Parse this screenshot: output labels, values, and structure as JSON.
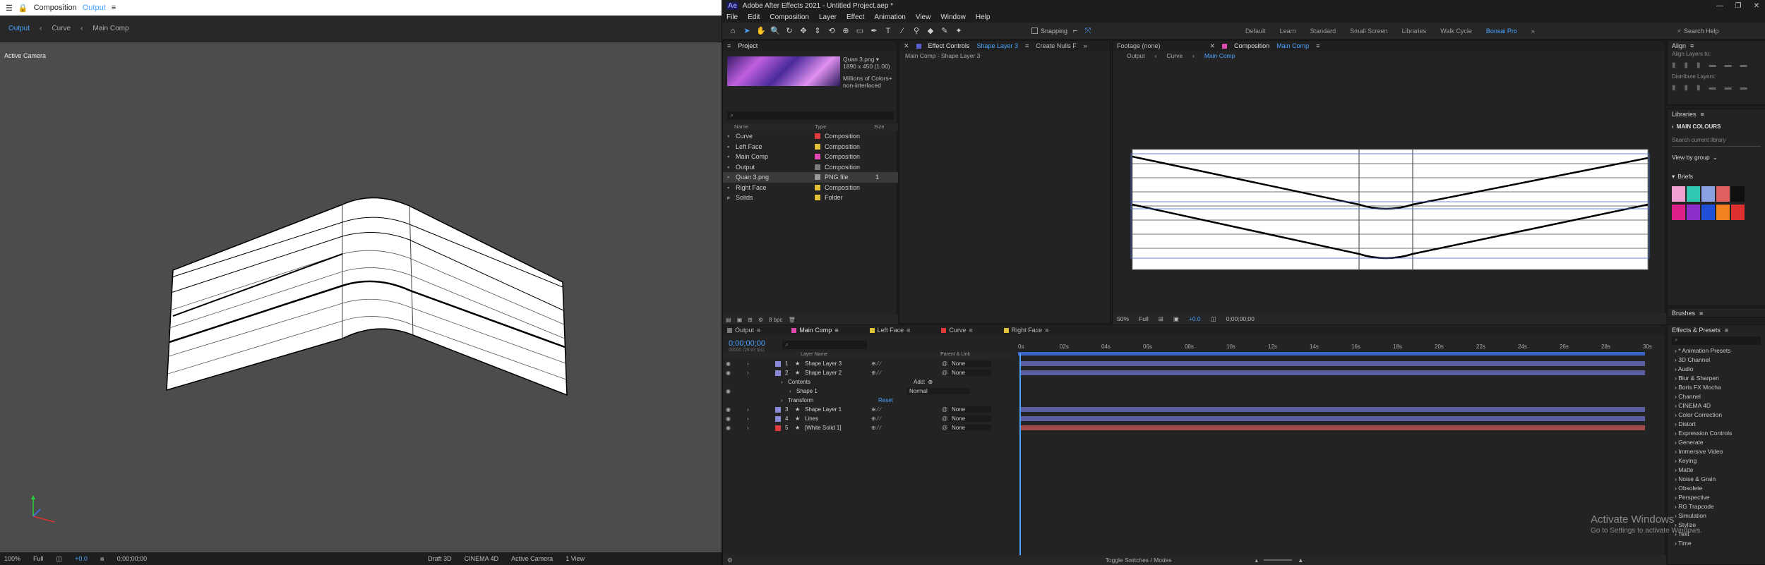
{
  "left_window": {
    "title": "Composition",
    "title_comp": "Output",
    "tabs": [
      "Output",
      "Curve",
      "Main Comp"
    ],
    "viewer_label": "Active Camera",
    "footer": [
      "100%",
      "Full",
      "+0.0",
      "0;00;00;00",
      "Draft 3D",
      "CINEMA 4D",
      "Active Camera",
      "1 View"
    ]
  },
  "app": {
    "title": "Adobe After Effects 2021 - Untitled Project.aep *",
    "menu": [
      "File",
      "Edit",
      "Composition",
      "Layer",
      "Effect",
      "Animation",
      "View",
      "Window",
      "Help"
    ],
    "snapping": "Snapping",
    "workspaces": [
      "Default",
      "Learn",
      "Standard",
      "Small Screen",
      "Libraries",
      "Walk Cycle",
      "Bonsai Pro"
    ],
    "search_help": "Search Help"
  },
  "project": {
    "tab": "Project",
    "thumb_name": "Quan 3.png ▾",
    "thumb_size": "1890 x 450 (1.00)",
    "thumb_info1": "Millions of Colors+",
    "thumb_info2": "non-interlaced",
    "columns": [
      "Name",
      "Type",
      "Size"
    ],
    "items": [
      {
        "name": "Curve",
        "type": "Composition",
        "color": "#e03a3a"
      },
      {
        "name": "Left Face",
        "type": "Composition",
        "color": "#e0c23a"
      },
      {
        "name": "Main Comp",
        "type": "Composition",
        "color": "#e04ab0"
      },
      {
        "name": "Output",
        "type": "Composition",
        "color": "#7a7a7a"
      },
      {
        "name": "Quan 3.png",
        "type": "PNG file",
        "color": "#9a9a9a",
        "size": "1"
      },
      {
        "name": "Right Face",
        "type": "Composition",
        "color": "#e0c23a"
      },
      {
        "name": "Solids",
        "type": "Folder",
        "color": "#e0c23a"
      }
    ],
    "bpc": "8 bpc"
  },
  "effect_controls": {
    "tab": "Effect Controls",
    "tab_layer": "Shape Layer 3",
    "tab2": "Create Nulls F",
    "breadcrumb": "Main Comp - Shape Layer 3"
  },
  "footage": {
    "tab": "Footage (none)"
  },
  "comp_panel": {
    "tab": "Composition",
    "tab_comp": "Main Comp",
    "tabs": [
      "Output",
      "Curve",
      "Main Comp"
    ],
    "footer": [
      "50%",
      "Full",
      "+0.0",
      "0;00;00;00"
    ]
  },
  "timeline": {
    "tabs": [
      {
        "name": "Output",
        "color": "#7a7a7a"
      },
      {
        "name": "Main Comp",
        "color": "#e04ab0"
      },
      {
        "name": "Left Face",
        "color": "#e0c23a"
      },
      {
        "name": "Curve",
        "color": "#e03a3a"
      },
      {
        "name": "Right Face",
        "color": "#e0c23a"
      }
    ],
    "timecode": "0;00;00;00",
    "fps": "00000 (29.97 fps)",
    "col_layer": "Layer Name",
    "col_parent": "Parent & Link",
    "ruler": [
      "0s",
      "02s",
      "04s",
      "06s",
      "08s",
      "10s",
      "12s",
      "14s",
      "16s",
      "18s",
      "20s",
      "22s",
      "24s",
      "26s",
      "28s",
      "30s"
    ],
    "layers": [
      {
        "num": "1",
        "name": "Shape Layer 3",
        "parent": "None",
        "color": "#8a8ad8",
        "bar": "#5a5fa0"
      },
      {
        "num": "2",
        "name": "Shape Layer 2",
        "parent": "None",
        "color": "#8a8ad8",
        "bar": "#5a5fa0"
      },
      {
        "num": "",
        "name": "Contents",
        "parent": "",
        "sub": true,
        "add": "Add:"
      },
      {
        "num": "",
        "name": "Shape 1",
        "parent": "",
        "sub2": true,
        "mode": "Normal"
      },
      {
        "num": "",
        "name": "Transform",
        "parent": "",
        "sub": true,
        "reset": "Reset"
      },
      {
        "num": "3",
        "name": "Shape Layer 1",
        "parent": "None",
        "color": "#8a8ad8",
        "bar": "#5a5fa0"
      },
      {
        "num": "4",
        "name": "Lines",
        "parent": "None",
        "color": "#8a8ad8",
        "bar": "#5a5fa0"
      },
      {
        "num": "5",
        "name": "[White Solid 1]",
        "parent": "None",
        "color": "#e03a3a",
        "bar": "#a04a4a"
      }
    ],
    "footer": "Toggle Switches / Modes"
  },
  "align": {
    "tab": "Align",
    "align_to": "Align Layers to:",
    "distribute": "Distribute Layers:"
  },
  "libraries": {
    "tab": "Libraries",
    "library_name": "MAIN COLOURS",
    "search": "Search current library",
    "view_by": "View by group",
    "group": "Briefs",
    "swatches_row1": [
      "#f0a0d0",
      "#30c8b0",
      "#8aa0e0",
      "#e06060",
      "#101010"
    ],
    "swatches_row2": [
      "#e0208a",
      "#8a30c8",
      "#2050d8",
      "#f08020",
      "#e03030"
    ]
  },
  "brushes": {
    "tab": "Brushes"
  },
  "effects_presets": {
    "tab": "Effects & Presets",
    "items": [
      "* Animation Presets",
      "3D Channel",
      "Audio",
      "Blur & Sharpen",
      "Boris FX Mocha",
      "Channel",
      "CINEMA 4D",
      "Color Correction",
      "Distort",
      "Expression Controls",
      "Generate",
      "Immersive Video",
      "Keying",
      "Matte",
      "Noise & Grain",
      "Obsolete",
      "Perspective",
      "RG Trapcode",
      "Simulation",
      "Stylize",
      "Text",
      "Time"
    ]
  },
  "watermark": {
    "line1": "Activate Windows",
    "line2": "Go to Settings to activate Windows."
  }
}
